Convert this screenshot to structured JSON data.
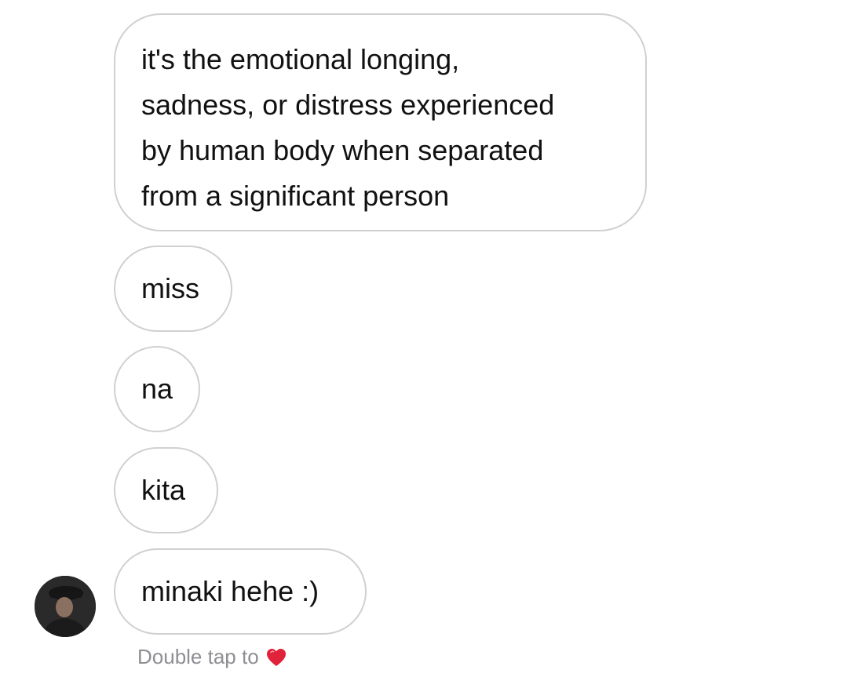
{
  "messages": [
    {
      "lines": [
        "it's the emotional longing,",
        "sadness, or distress experienced",
        "by human body when separated",
        "from a significant person"
      ]
    },
    {
      "text": "miss"
    },
    {
      "text": "na"
    },
    {
      "text": "kita"
    },
    {
      "text": "minaki hehe :)"
    }
  ],
  "avatar": {
    "icon": "profile-photo"
  },
  "footer": {
    "hint_text": "Double tap to",
    "heart_icon": "heart-icon",
    "heart_color": "#e0223a"
  }
}
